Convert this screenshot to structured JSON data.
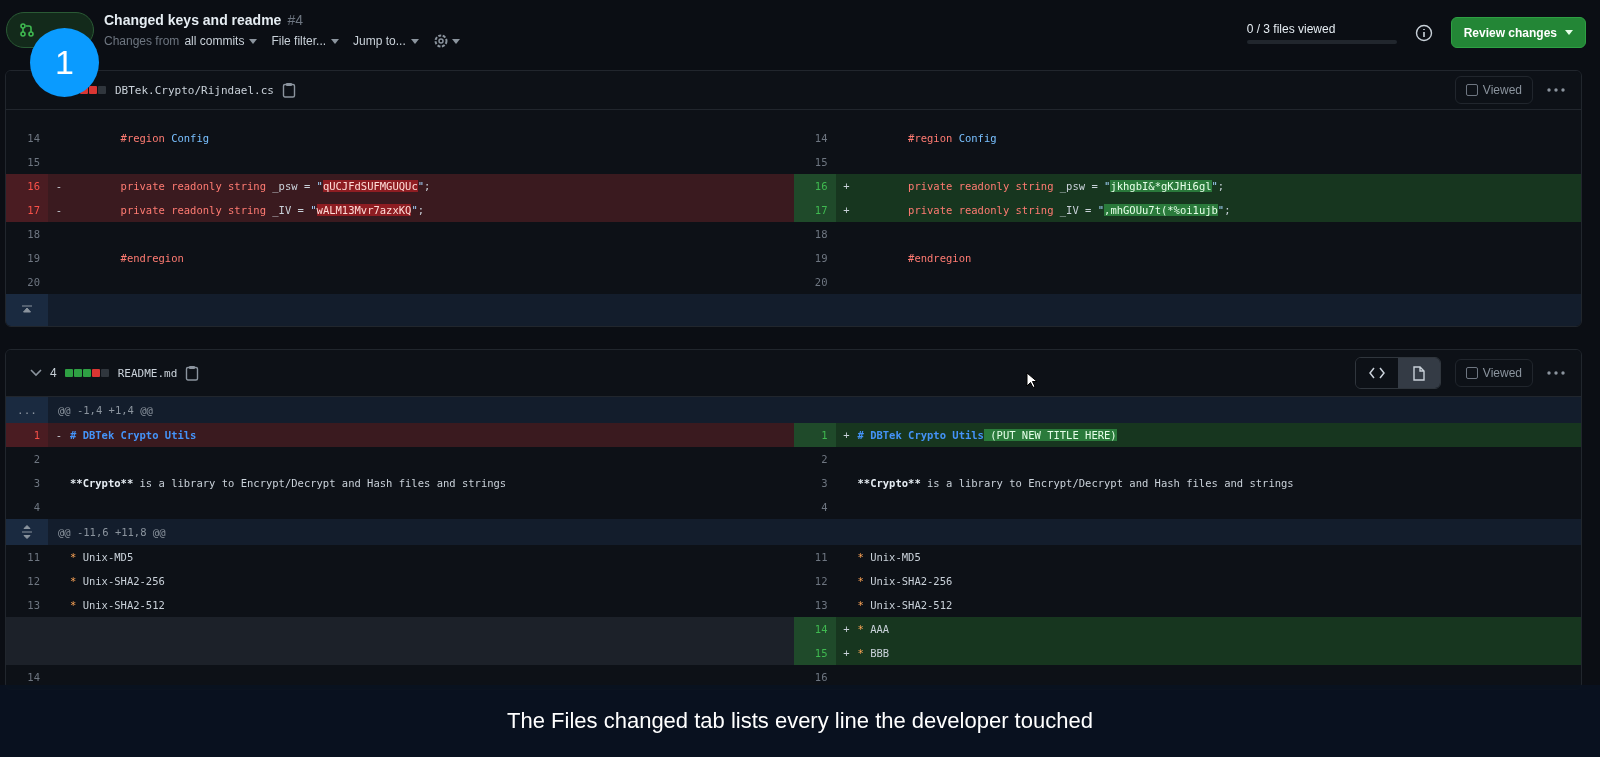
{
  "pull_request": {
    "title": "Changed keys and readme",
    "number": "#4"
  },
  "toolbar": {
    "changes_prefix": "Changes from",
    "changes_value": "all commits",
    "file_filter": "File filter...",
    "jump_to": "Jump to..."
  },
  "progress": {
    "label": "0 / 3 files viewed"
  },
  "review_button": "Review changes",
  "step_badge": "1",
  "caption": "The Files changed tab lists every line the developer touched",
  "files": [
    {
      "collapse_icon": false,
      "diffstat": [
        {
          "kind": "deleted"
        },
        {
          "kind": "deleted"
        },
        {
          "kind": "neutral"
        }
      ],
      "name": "DBTek.Crypto/Rijndael.cs",
      "viewed_label": "Viewed",
      "viewed": false,
      "rows": [
        {
          "kind": "line",
          "left": {
            "kind": "context",
            "num": "14",
            "tokens": [
              {
                "kind": "keyword",
                "text": "        #region"
              },
              {
                "kind": "name",
                "text": " Config"
              }
            ]
          },
          "right": {
            "kind": "context",
            "num": "14",
            "tokens": [
              {
                "kind": "keyword",
                "text": "        #region"
              },
              {
                "kind": "name",
                "text": " Config"
              }
            ]
          }
        },
        {
          "kind": "line",
          "left": {
            "kind": "context",
            "num": "15"
          },
          "right": {
            "kind": "context",
            "num": "15"
          }
        },
        {
          "kind": "line",
          "left": {
            "kind": "deleted",
            "num": "16",
            "marker": "-",
            "tokens": [
              {
                "kind": "keyword",
                "text": "        private readonly string"
              },
              {
                "kind": "plain",
                "text": " _psw = "
              },
              {
                "kind": "string",
                "text": "\""
              },
              {
                "kind": "highlight",
                "text": "qUCJFdSUFMGUQUc"
              },
              {
                "kind": "string",
                "text": "\""
              },
              {
                "kind": "plain",
                "text": ";"
              }
            ]
          },
          "right": {
            "kind": "added",
            "num": "16",
            "marker": "+",
            "tokens": [
              {
                "kind": "keyword",
                "text": "        private readonly string"
              },
              {
                "kind": "plain",
                "text": " _psw = "
              },
              {
                "kind": "string",
                "text": "\""
              },
              {
                "kind": "highlight",
                "text": "jkhgbI&*gKJHi6gl"
              },
              {
                "kind": "string",
                "text": "\""
              },
              {
                "kind": "plain",
                "text": ";"
              }
            ]
          }
        },
        {
          "kind": "line",
          "left": {
            "kind": "deleted",
            "num": "17",
            "marker": "-",
            "tokens": [
              {
                "kind": "keyword",
                "text": "        private readonly string"
              },
              {
                "kind": "plain",
                "text": " _IV = "
              },
              {
                "kind": "string",
                "text": "\""
              },
              {
                "kind": "highlight",
                "text": "wALM13Mvr7azxKQ"
              },
              {
                "kind": "string",
                "text": "\""
              },
              {
                "kind": "plain",
                "text": ";"
              }
            ]
          },
          "right": {
            "kind": "added",
            "num": "17",
            "marker": "+",
            "tokens": [
              {
                "kind": "keyword",
                "text": "        private readonly string"
              },
              {
                "kind": "plain",
                "text": " _IV = "
              },
              {
                "kind": "string",
                "text": "\""
              },
              {
                "kind": "highlight",
                "text": ",mhGOUu7t(*%oi1ujb"
              },
              {
                "kind": "string",
                "text": "\""
              },
              {
                "kind": "plain",
                "text": ";"
              }
            ]
          }
        },
        {
          "kind": "line",
          "left": {
            "kind": "context",
            "num": "18"
          },
          "right": {
            "kind": "context",
            "num": "18"
          }
        },
        {
          "kind": "line",
          "left": {
            "kind": "context",
            "num": "19",
            "tokens": [
              {
                "kind": "keyword",
                "text": "        #endregion"
              }
            ]
          },
          "right": {
            "kind": "context",
            "num": "19",
            "tokens": [
              {
                "kind": "keyword",
                "text": "        #endregion"
              }
            ]
          }
        },
        {
          "kind": "line",
          "left": {
            "kind": "context",
            "num": "20"
          },
          "right": {
            "kind": "context",
            "num": "20"
          }
        },
        {
          "kind": "expand",
          "expand_icon": true
        }
      ]
    },
    {
      "collapse_icon": true,
      "count": "4",
      "diffstat": [
        {
          "kind": "added"
        },
        {
          "kind": "added"
        },
        {
          "kind": "added"
        },
        {
          "kind": "deleted"
        },
        {
          "kind": "neutral"
        }
      ],
      "name": "README.md",
      "view_toggle": [
        {
          "kind": "source",
          "selected": false
        },
        {
          "kind": "rich",
          "selected": true
        }
      ],
      "viewed_label": "Viewed",
      "viewed": false,
      "rows": [
        {
          "kind": "hunk",
          "gutter": "...",
          "expand_icon": false,
          "text": "@@ -1,4 +1,4 @@"
        },
        {
          "kind": "line",
          "left": {
            "kind": "deleted",
            "num": "1",
            "marker": "-",
            "tokens": [
              {
                "kind": "heading",
                "text": "# DBTek Crypto Utils"
              }
            ]
          },
          "right": {
            "kind": "added",
            "num": "1",
            "marker": "+",
            "tokens": [
              {
                "kind": "heading",
                "text": "# DBTek Crypto Utils"
              },
              {
                "kind": "highlight",
                "text": " (PUT NEW TITLE HERE)"
              }
            ]
          }
        },
        {
          "kind": "line",
          "left": {
            "kind": "context",
            "num": "2"
          },
          "right": {
            "kind": "context",
            "num": "2"
          }
        },
        {
          "kind": "line",
          "left": {
            "kind": "context",
            "num": "3",
            "tokens": [
              {
                "kind": "bold",
                "text": "**Crypto**"
              },
              {
                "kind": "plain",
                "text": " is a library to Encrypt/Decrypt and Hash files and strings"
              }
            ]
          },
          "right": {
            "kind": "context",
            "num": "3",
            "tokens": [
              {
                "kind": "bold",
                "text": "**Crypto**"
              },
              {
                "kind": "plain",
                "text": " is a library to Encrypt/Decrypt and Hash files and strings"
              }
            ]
          }
        },
        {
          "kind": "line",
          "left": {
            "kind": "context",
            "num": "4"
          },
          "right": {
            "kind": "context",
            "num": "4"
          }
        },
        {
          "kind": "hunk",
          "expand_icon": true,
          "text": "@@ -11,6 +11,8 @@"
        },
        {
          "kind": "line",
          "left": {
            "kind": "context",
            "num": "11",
            "tokens": [
              {
                "kind": "bullet",
                "text": "*"
              },
              {
                "kind": "plain",
                "text": " Unix-MD5"
              }
            ]
          },
          "right": {
            "kind": "context",
            "num": "11",
            "tokens": [
              {
                "kind": "bullet",
                "text": "*"
              },
              {
                "kind": "plain",
                "text": " Unix-MD5"
              }
            ]
          }
        },
        {
          "kind": "line",
          "left": {
            "kind": "context",
            "num": "12",
            "tokens": [
              {
                "kind": "bullet",
                "text": "*"
              },
              {
                "kind": "plain",
                "text": " Unix-SHA2-256"
              }
            ]
          },
          "right": {
            "kind": "context",
            "num": "12",
            "tokens": [
              {
                "kind": "bullet",
                "text": "*"
              },
              {
                "kind": "plain",
                "text": " Unix-SHA2-256"
              }
            ]
          }
        },
        {
          "kind": "line",
          "left": {
            "kind": "context",
            "num": "13",
            "tokens": [
              {
                "kind": "bullet",
                "text": "*"
              },
              {
                "kind": "plain",
                "text": " Unix-SHA2-512"
              }
            ]
          },
          "right": {
            "kind": "context",
            "num": "13",
            "tokens": [
              {
                "kind": "bullet",
                "text": "*"
              },
              {
                "kind": "plain",
                "text": " Unix-SHA2-512"
              }
            ]
          }
        },
        {
          "kind": "line",
          "left": {
            "kind": "empty"
          },
          "right": {
            "kind": "added",
            "num": "14",
            "marker": "+",
            "tokens": [
              {
                "kind": "bullet",
                "text": "*"
              },
              {
                "kind": "plain",
                "text": " AAA"
              }
            ]
          }
        },
        {
          "kind": "line",
          "left": {
            "kind": "empty"
          },
          "right": {
            "kind": "added",
            "num": "15",
            "marker": "+",
            "tokens": [
              {
                "kind": "bullet",
                "text": "*"
              },
              {
                "kind": "plain",
                "text": " BBB"
              }
            ]
          }
        },
        {
          "kind": "line",
          "left": {
            "kind": "context",
            "num": "14"
          },
          "right": {
            "kind": "context",
            "num": "16"
          }
        }
      ]
    }
  ]
}
